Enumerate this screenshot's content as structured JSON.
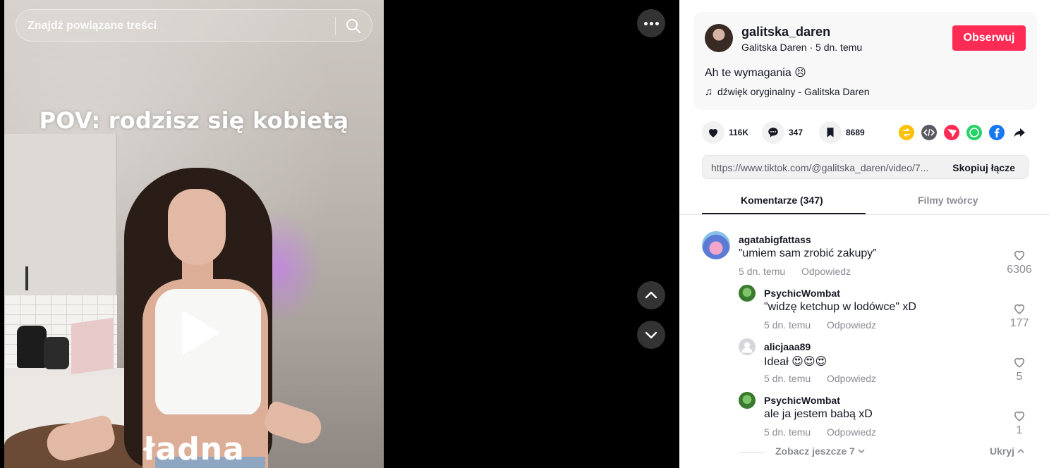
{
  "video": {
    "search_placeholder": "Znajdź powiązane treści",
    "caption_overlay": "POV: rodzisz się kobietą",
    "caption_word": "ładna"
  },
  "author": {
    "username": "galitska_daren",
    "display_name": "Galitska Daren",
    "posted": "5 dn. temu",
    "meta_line": "Galitska Daren · 5 dn. temu",
    "follow_label": "Obserwuj",
    "description": "Ah te wymagania 😣",
    "music": "dźwięk oryginalny - Galitska Daren"
  },
  "stats": {
    "likes": "116K",
    "comments": "347",
    "saves": "8689"
  },
  "share_icons": [
    "repost-icon",
    "embed-icon",
    "send-icon",
    "whatsapp-icon",
    "facebook-icon",
    "share-arrow-icon"
  ],
  "link": {
    "url": "https://www.tiktok.com/@galitska_daren/video/7...",
    "copy_label": "Skopiuj łącze"
  },
  "tabs": {
    "comments": "Komentarze (347)",
    "creator_videos": "Filmy twórcy"
  },
  "comments": [
    {
      "user": "agatabigfattass",
      "text": "”umiem sam zrobić zakupy”",
      "time": "5 dn. temu",
      "reply": "Odpowiedz",
      "likes": "6306"
    },
    {
      "user": "PsychicWombat",
      "text": "\"widzę ketchup w lodówce\" xD",
      "time": "5 dn. temu",
      "reply": "Odpowiedz",
      "likes": "177"
    },
    {
      "user": "alicjaaa89",
      "text": "Ideał 😍😍😍",
      "time": "5 dn. temu",
      "reply": "Odpowiedz",
      "likes": "5"
    },
    {
      "user": "PsychicWombat",
      "text": "ale ja jestem babą xD",
      "time": "5 dn. temu",
      "reply": "Odpowiedz",
      "likes": "1"
    }
  ],
  "replies_footer": {
    "view_more": "Zobacz jeszcze 7",
    "hide": "Ukryj"
  },
  "colors": {
    "accent": "#fe2c55",
    "text": "#161823",
    "muted": "#8a8b91"
  }
}
